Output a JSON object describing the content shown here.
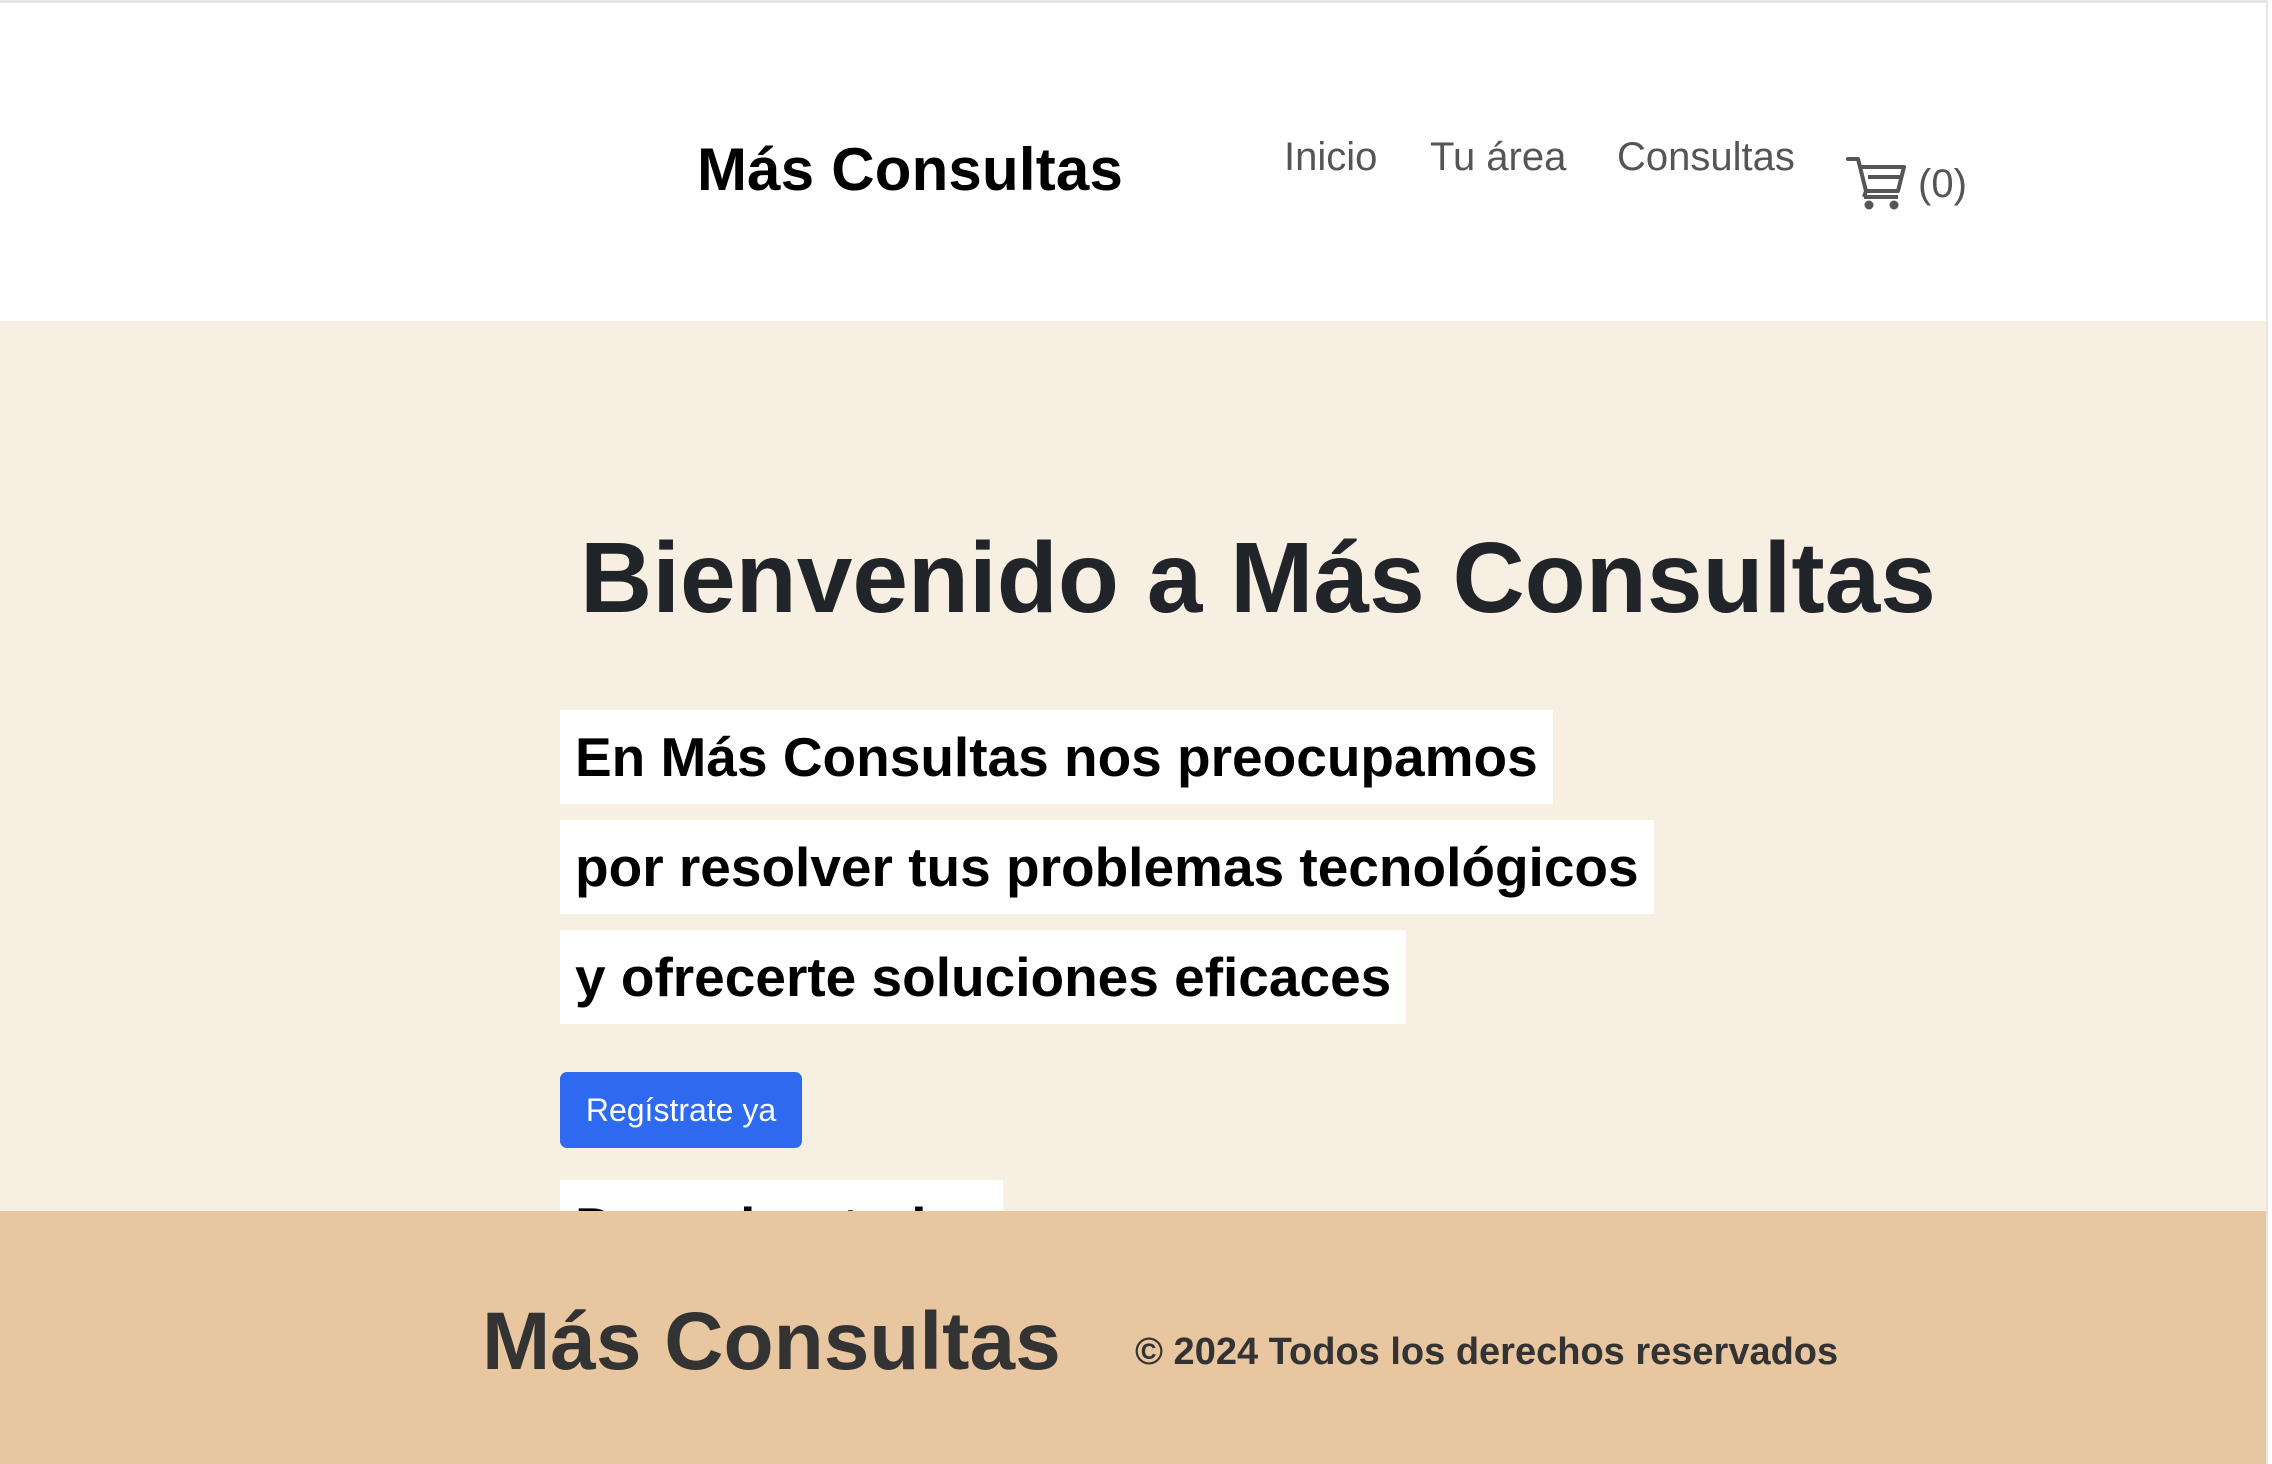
{
  "header": {
    "brand": "Más Consultas",
    "nav": [
      {
        "label": "Inicio"
      },
      {
        "label": "Tu área"
      },
      {
        "label": "Consultas"
      }
    ],
    "cart_count": "(0)",
    "cart_icon": "cart-icon"
  },
  "hero": {
    "title": "Bienvenido a Más Consultas",
    "lines": [
      "En Más Consultas nos preocupamos",
      "por resolver tus problemas tecnológicos",
      "y ofrecerte soluciones eficaces"
    ],
    "cta_label": "Regístrate ya",
    "partial_text": "Descubre todas"
  },
  "footer": {
    "brand": "Más Consultas",
    "copyright": "© 2024 Todos los derechos reservados"
  },
  "colors": {
    "hero_bg": "#f8efe3",
    "footer_bg": "#e8c7a0",
    "cta_bg": "#2e6af0"
  }
}
